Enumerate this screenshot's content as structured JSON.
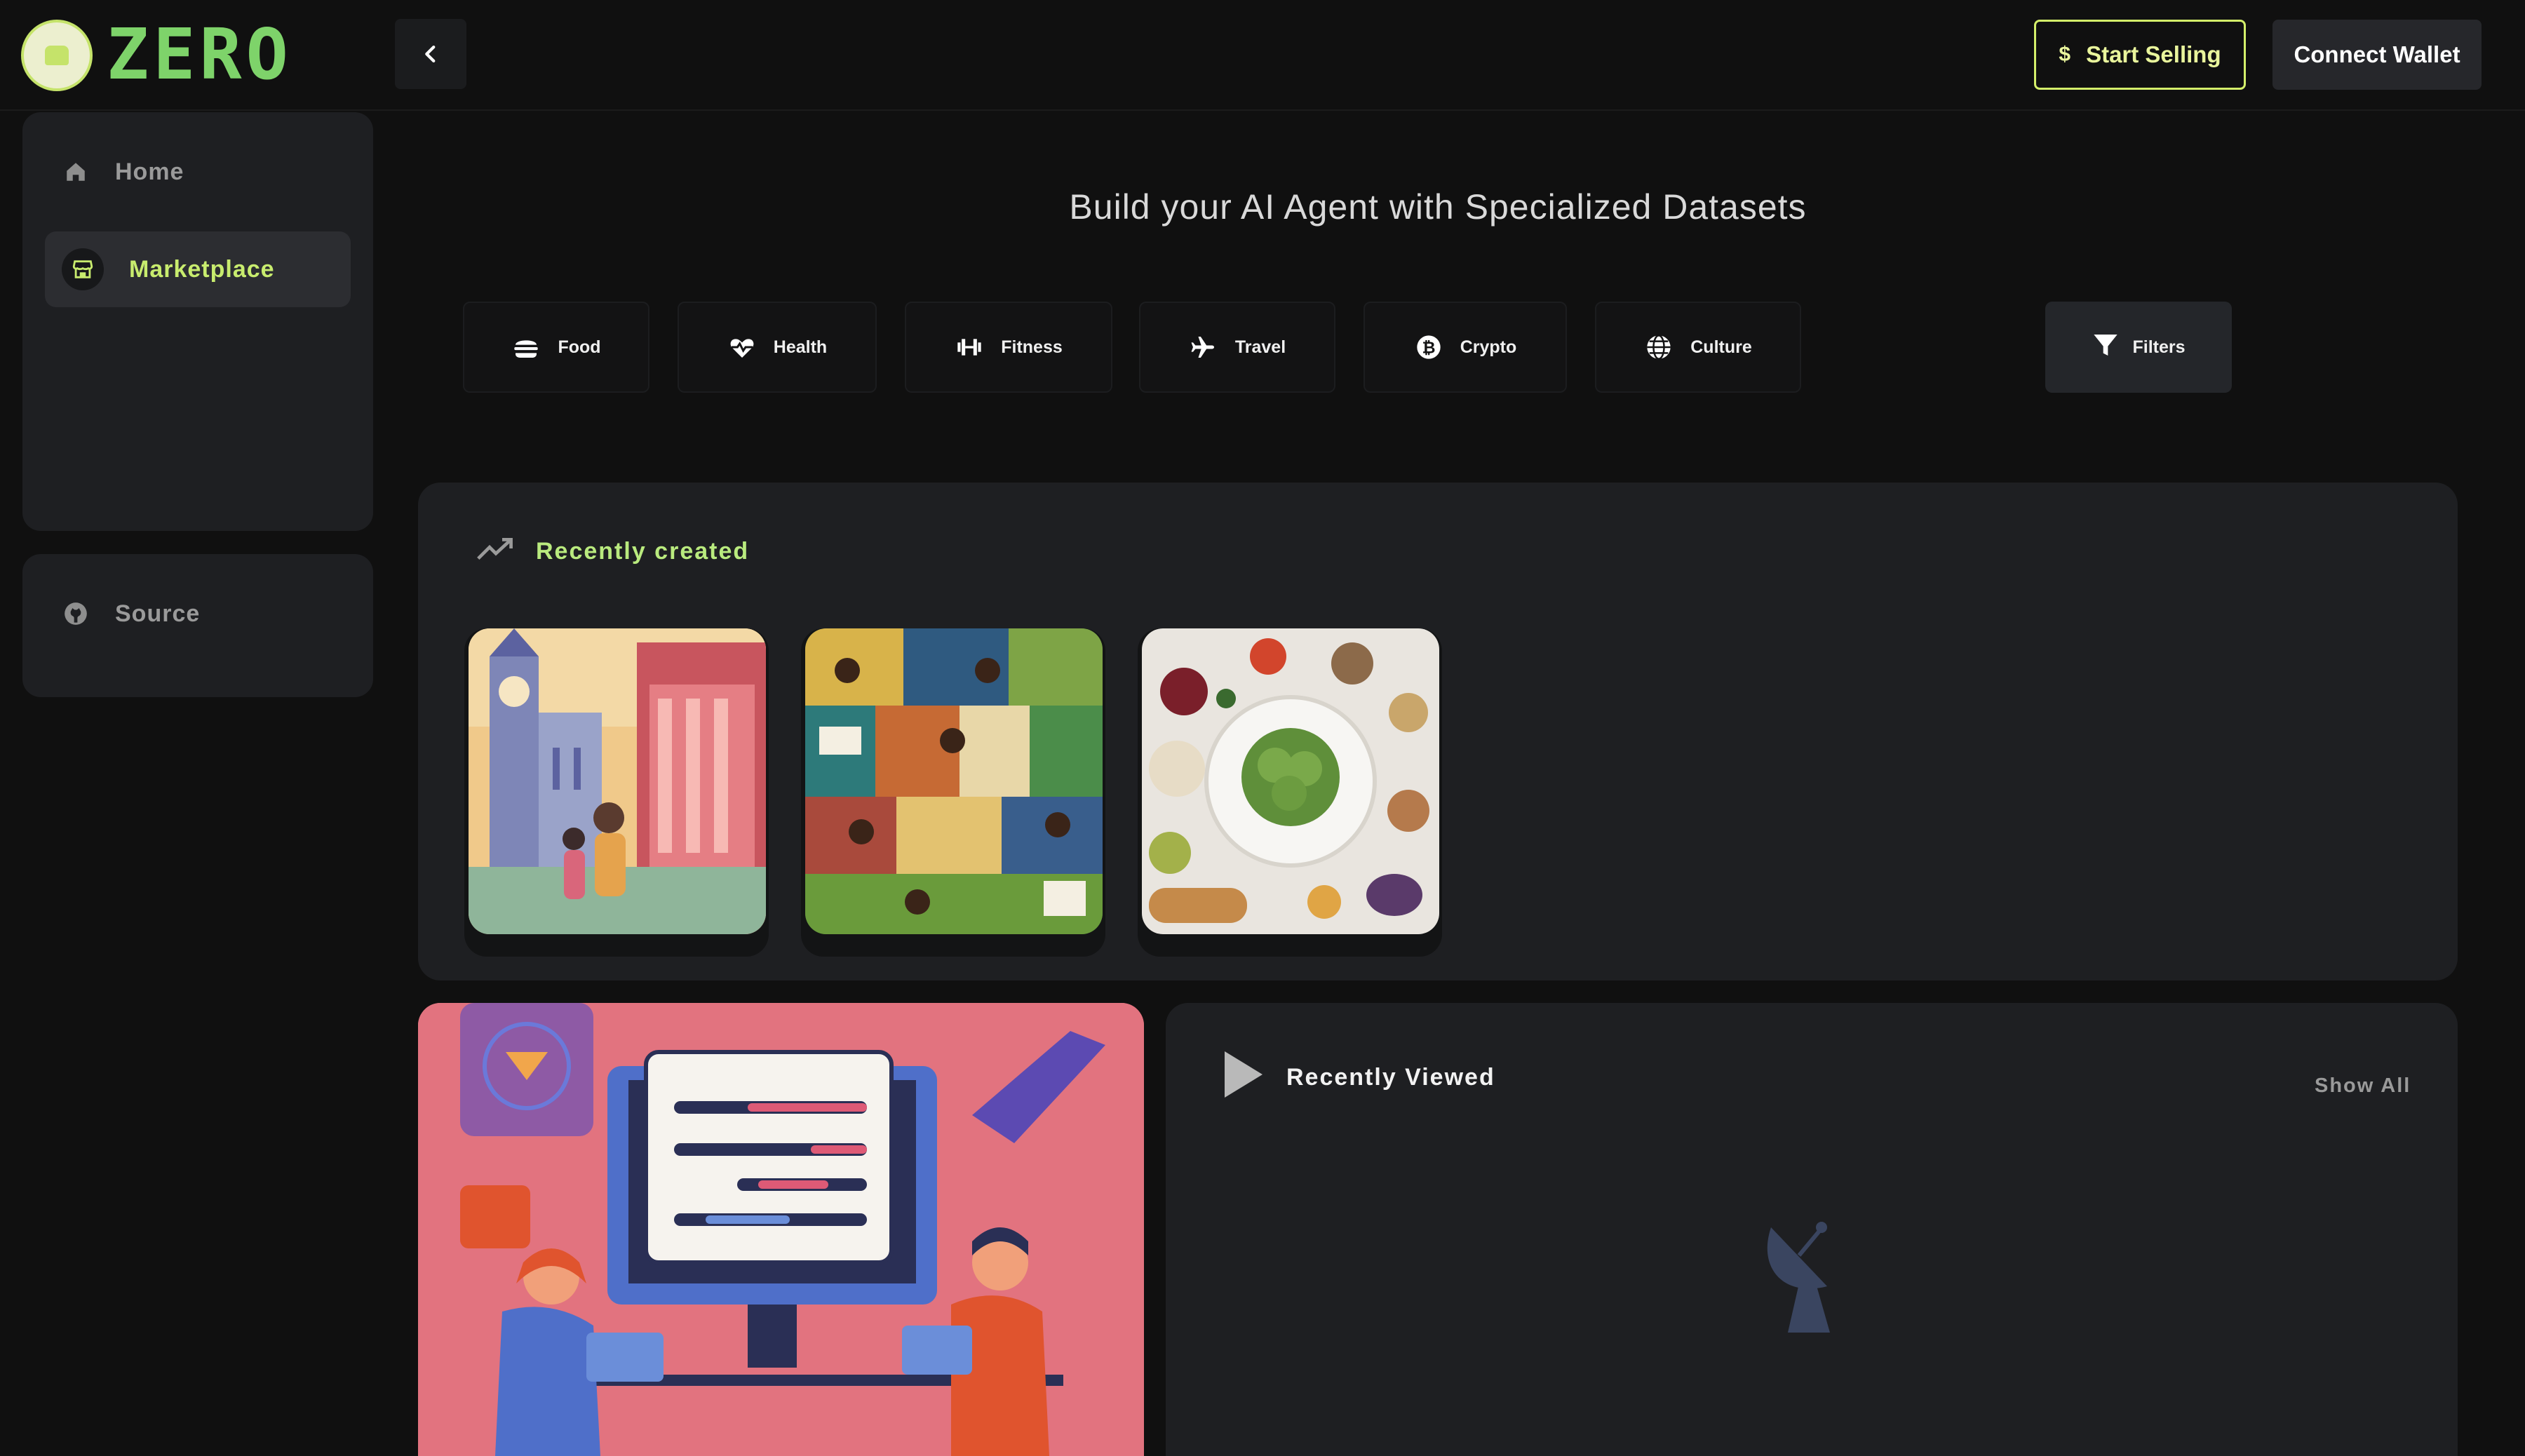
{
  "brand": {
    "logo_text": "ZERO",
    "accent": "#c8ec6e"
  },
  "header": {
    "start_selling": {
      "icon": "dollar-icon",
      "label": "Start Selling"
    },
    "connect_wallet": "Connect Wallet"
  },
  "sidebar": {
    "items": [
      {
        "icon": "home-icon",
        "label": "Home"
      },
      {
        "icon": "store-icon",
        "label": "Marketplace",
        "active": true
      }
    ],
    "source": {
      "icon": "github-icon",
      "label": "Source"
    }
  },
  "main": {
    "headline": "Build your AI Agent with Specialized Datasets",
    "categories": [
      {
        "icon": "burger-icon",
        "label": "Food"
      },
      {
        "icon": "heart-pulse-icon",
        "label": "Health"
      },
      {
        "icon": "dumbbell-icon",
        "label": "Fitness"
      },
      {
        "icon": "plane-icon",
        "label": "Travel"
      },
      {
        "icon": "bitcoin-icon",
        "label": "Crypto"
      },
      {
        "icon": "globe-icon",
        "label": "Culture"
      }
    ],
    "filters_label": "Filters",
    "recently_created": {
      "title": "Recently created",
      "cards": [
        "london-travel-illustration",
        "culture-collage-illustration",
        "food-ingredients-photo"
      ]
    },
    "recently_viewed": {
      "title": "Recently Viewed",
      "show_all": "Show All",
      "empty_icon": "satellite-dish-icon"
    }
  }
}
